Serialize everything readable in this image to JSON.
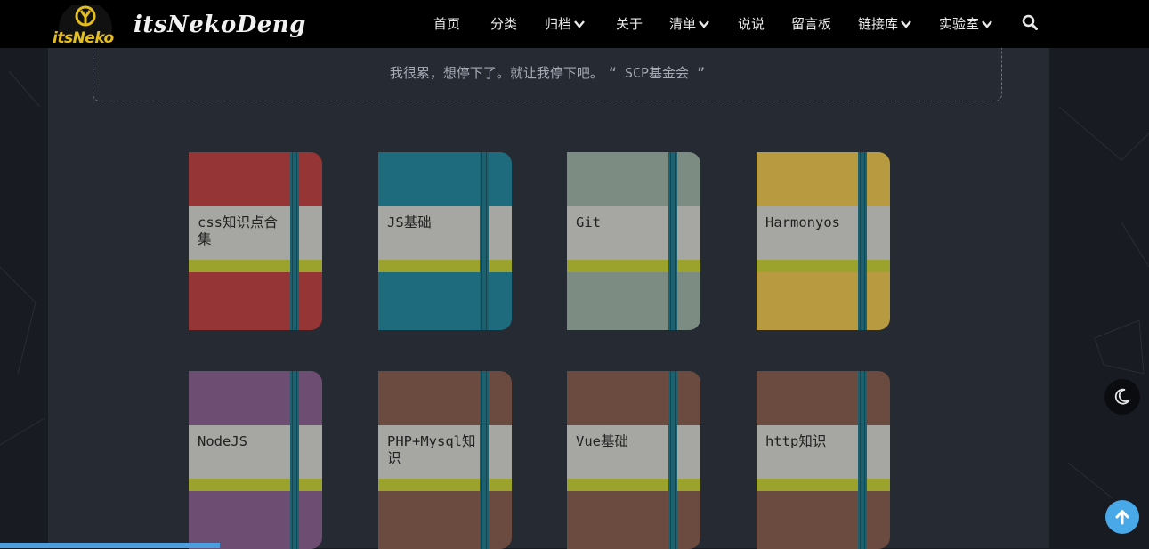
{
  "header": {
    "logo_text": "itsNeko",
    "site_title": "itsNekoDeng",
    "nav": [
      {
        "label": "首页",
        "dropdown": false
      },
      {
        "label": "分类",
        "dropdown": false
      },
      {
        "label": "归档",
        "dropdown": true
      },
      {
        "label": "关于",
        "dropdown": false
      },
      {
        "label": "清单",
        "dropdown": true
      },
      {
        "label": "说说",
        "dropdown": false
      },
      {
        "label": "留言板",
        "dropdown": false
      },
      {
        "label": "链接库",
        "dropdown": true
      },
      {
        "label": "实验室",
        "dropdown": true
      }
    ],
    "search_icon": "search-icon"
  },
  "quote": {
    "text": "我很累，想停下了。就让我停下吧。",
    "source": "“ SCP基金会 ”"
  },
  "notebooks": [
    {
      "title": "css知识点合集",
      "cover_color": "#963535"
    },
    {
      "title": "JS基础",
      "cover_color": "#1f6b7e"
    },
    {
      "title": "Git",
      "cover_color": "#7c8c83"
    },
    {
      "title": "Harmonyos",
      "cover_color": "#b89a40"
    },
    {
      "title": "NodeJS",
      "cover_color": "#6e4d72"
    },
    {
      "title": "PHP+Mysql知识",
      "cover_color": "#6b4a3f"
    },
    {
      "title": "Vue基础",
      "cover_color": "#6b4a3f"
    },
    {
      "title": "http知识",
      "cover_color": "#6b4a3f"
    }
  ],
  "floating": {
    "theme_toggle_icon": "moon-icon",
    "back_to_top_icon": "arrow-up-icon"
  },
  "colors": {
    "accent": "#49a8e8",
    "logo": "#e4bd1f",
    "label_paper": "#a6a7a2",
    "stripe": "#9ba32d",
    "band": "#1d6170"
  }
}
